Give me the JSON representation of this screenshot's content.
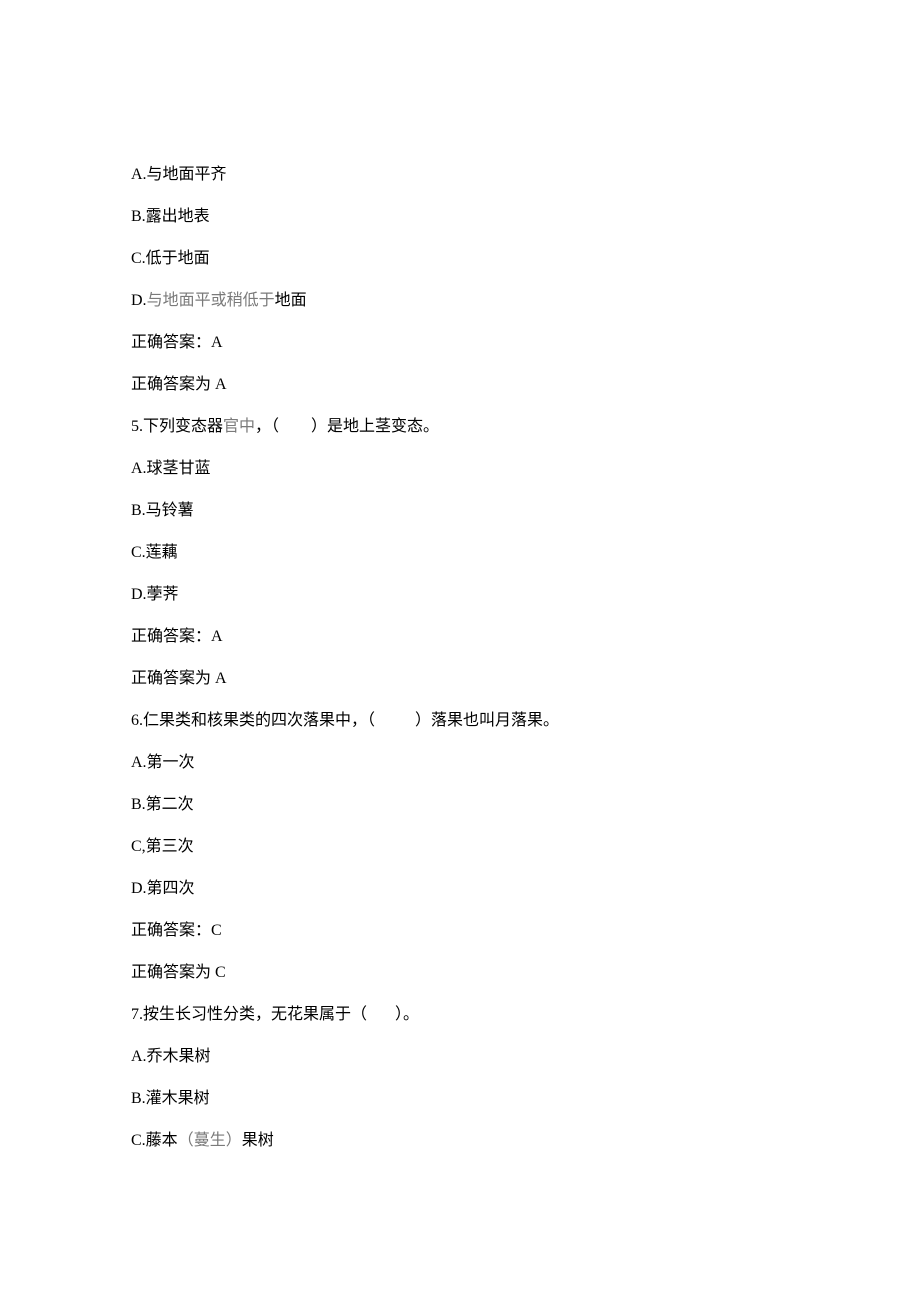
{
  "q4": {
    "optA": "A.与地面平齐",
    "optB": "B.露出地表",
    "optC": "C.低于地面",
    "optD_pre": "D.",
    "optD_mid": "与地面平或稍低于",
    "optD_post": "地面",
    "ans1": "正确答案：A",
    "ans2": "正确答案为 A"
  },
  "q5": {
    "stem_pre": "5.下列变态器",
    "stem_mid": "官中",
    "stem_post": "，（        ）是地上茎变态。",
    "optA": "A.球茎甘蓝",
    "optB": "B.马铃薯",
    "optC": "C.莲藕",
    "optD": "D.荸荠",
    "ans1": "正确答案：A",
    "ans2": "正确答案为 A"
  },
  "q6": {
    "stem": "6.仁果类和核果类的四次落果中，（          ）落果也叫月落果。",
    "optA": "A.第一次",
    "optB": "B.第二次",
    "optC": "C,第三次",
    "optD": "D.第四次",
    "ans1": "正确答案：C",
    "ans2": "正确答案为 C"
  },
  "q7": {
    "stem": "7.按生长习性分类，无花果属于（       ）。",
    "optA": "A.乔木果树",
    "optB": "B.灌木果树",
    "optC_pre": "C.藤本",
    "optC_mid": "（蔓生）",
    "optC_post": "果树"
  }
}
